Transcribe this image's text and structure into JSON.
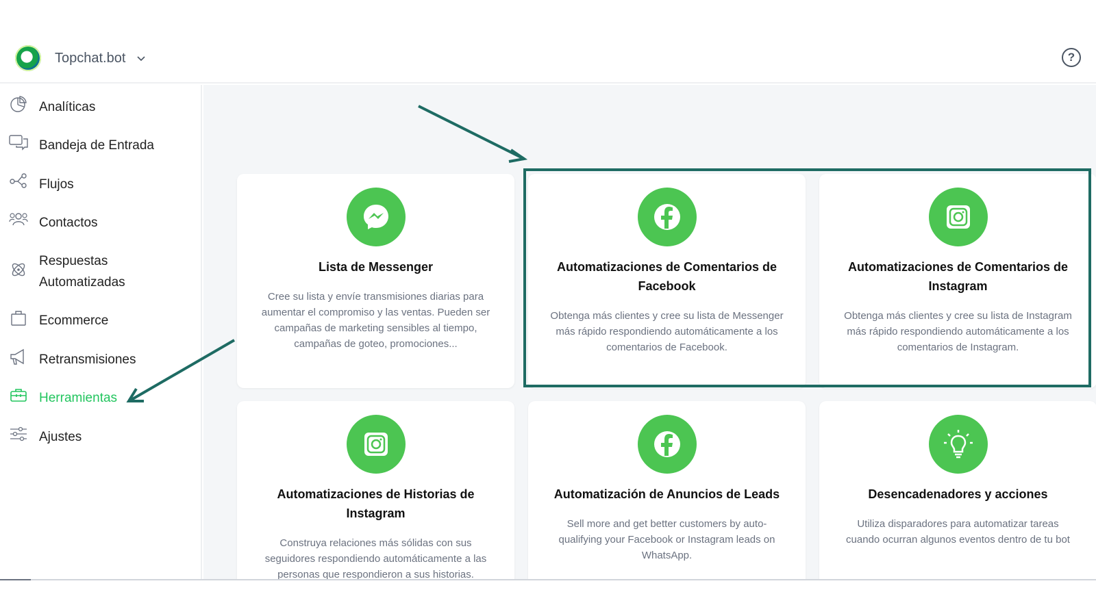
{
  "header": {
    "brand_name": "Topchat.bot",
    "help_label": "?"
  },
  "sidebar": {
    "items": [
      {
        "label": "Analíticas",
        "icon": "pie-chart-icon"
      },
      {
        "label": "Bandeja de Entrada",
        "icon": "chat-bubbles-icon"
      },
      {
        "label": "Flujos",
        "icon": "flow-icon"
      },
      {
        "label": "Contactos",
        "icon": "users-icon"
      },
      {
        "label": "Respuestas",
        "label2": "Automatizadas",
        "icon": "atom-icon"
      },
      {
        "label": "Ecommerce",
        "icon": "shopping-bag-icon"
      },
      {
        "label": "Retransmisiones",
        "icon": "megaphone-icon"
      },
      {
        "label": "Herramientas",
        "icon": "toolbox-icon",
        "active": true
      },
      {
        "label": "Ajustes",
        "icon": "sliders-icon"
      }
    ]
  },
  "cards": [
    {
      "title": "Lista de Messenger",
      "desc": [
        "Cree su lista y envíe transmisiones diarias para",
        "aumentar el compromiso y las ventas. Pueden ser",
        "campañas de marketing sensibles al tiempo,",
        "campañas de goteo, promociones..."
      ],
      "icon": "messenger-icon"
    },
    {
      "title": [
        "Automatizaciones de Comentarios de",
        "Facebook"
      ],
      "desc": [
        "Obtenga más clientes y cree su lista de Messenger",
        "más rápido respondiendo automáticamente a los",
        "comentarios de Facebook."
      ],
      "icon": "facebook-icon"
    },
    {
      "title": [
        "Automatizaciones de Comentarios de",
        "Instagram"
      ],
      "desc": [
        "Obtenga más clientes y cree su lista de Instagram",
        "más rápido respondiendo automáticamente a los",
        "comentarios de Instagram."
      ],
      "icon": "instagram-icon"
    },
    {
      "title": [
        "Automatizaciones de Historias de",
        "Instagram"
      ],
      "desc": [
        "Construya relaciones más sólidas con sus",
        "seguidores respondiendo automáticamente a las",
        "personas que respondieron a sus historias."
      ],
      "icon": "instagram-icon"
    },
    {
      "title": "Automatización de Anuncios de Leads",
      "desc": [
        "Sell more and get better customers by auto-",
        "qualifying your Facebook or Instagram leads on",
        "WhatsApp."
      ],
      "icon": "facebook-icon"
    },
    {
      "title": "Desencadenadores y acciones",
      "desc": [
        "Utiliza disparadores para automatizar tareas",
        "cuando ocurran algunos eventos dentro de tu bot"
      ],
      "icon": "lightbulb-icon"
    }
  ],
  "colors": {
    "accent": "#4cc552",
    "active_text": "#22c55e",
    "annotation": "#1e6b63"
  }
}
